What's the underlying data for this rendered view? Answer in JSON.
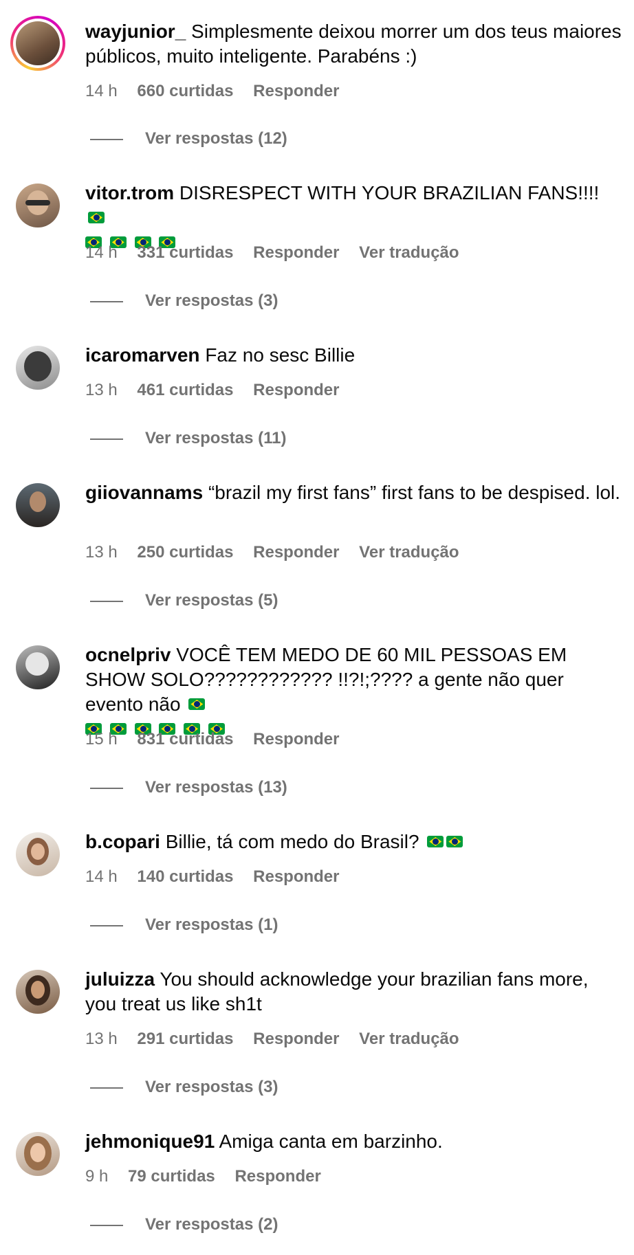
{
  "comments": [
    {
      "username": "wayjunior_",
      "text": "Simplesmente deixou morrer um dos teus maiores públicos, muito inteligente. Parabéns :)",
      "flags_inline": 0,
      "flags_extra": 0,
      "time": "14 h",
      "likes": "660 curtidas",
      "reply": "Responder",
      "translate": "",
      "replies": "Ver respostas (12)",
      "has_story_ring": true
    },
    {
      "username": "vitor.trom",
      "text": "DISRESPECT WITH YOUR BRAZILIAN FANS!!!!",
      "flags_inline": 1,
      "flags_extra": 4,
      "time": "14 h",
      "likes": "331 curtidas",
      "reply": "Responder",
      "translate": "Ver tradução",
      "replies": "Ver respostas (3)",
      "has_story_ring": false
    },
    {
      "username": "icaromarven",
      "text": "Faz no sesc Billie",
      "flags_inline": 0,
      "flags_extra": 0,
      "time": "13 h",
      "likes": "461 curtidas",
      "reply": "Responder",
      "translate": "",
      "replies": "Ver respostas (11)",
      "has_story_ring": false
    },
    {
      "username": "giiovannams",
      "text": "“brazil my first fans” first fans to be despised. lol.",
      "flags_inline": 0,
      "flags_extra": 0,
      "time": "13 h",
      "likes": "250 curtidas",
      "reply": "Responder",
      "translate": "Ver tradução",
      "replies": "Ver respostas (5)",
      "has_story_ring": false
    },
    {
      "username": "ocnelpriv",
      "text": "VOCÊ TEM MEDO DE 60 MIL PESSOAS EM SHOW SOLO???????????? !!?!;???? a gente não quer evento não",
      "flags_inline": 1,
      "flags_extra": 6,
      "time": "15 h",
      "likes": "831 curtidas",
      "reply": "Responder",
      "translate": "",
      "replies": "Ver respostas (13)",
      "has_story_ring": false
    },
    {
      "username": "b.copari",
      "text": "Billie, tá com medo do Brasil?",
      "flags_inline": 2,
      "flags_extra": 0,
      "time": "14 h",
      "likes": "140 curtidas",
      "reply": "Responder",
      "translate": "",
      "replies": "Ver respostas (1)",
      "has_story_ring": false
    },
    {
      "username": "juluizza",
      "text": "You should acknowledge your brazilian fans more, you treat us like sh1t",
      "flags_inline": 0,
      "flags_extra": 0,
      "time": "13 h",
      "likes": "291 curtidas",
      "reply": "Responder",
      "translate": "Ver tradução",
      "replies": "Ver respostas (3)",
      "has_story_ring": false
    },
    {
      "username": "jehmonique91",
      "text": "Amiga canta em barzinho.",
      "flags_inline": 0,
      "flags_extra": 0,
      "time": "9 h",
      "likes": "79 curtidas",
      "reply": "Responder",
      "translate": "",
      "replies": "Ver respostas (2)",
      "has_story_ring": false
    }
  ],
  "icons": {
    "flag": "brazil-flag-emoji"
  },
  "colors": {
    "text": "#0a0a0a",
    "secondary": "#737373",
    "flag_green": "#009c3b",
    "flag_yellow": "#ffdf00",
    "flag_blue": "#002776"
  }
}
